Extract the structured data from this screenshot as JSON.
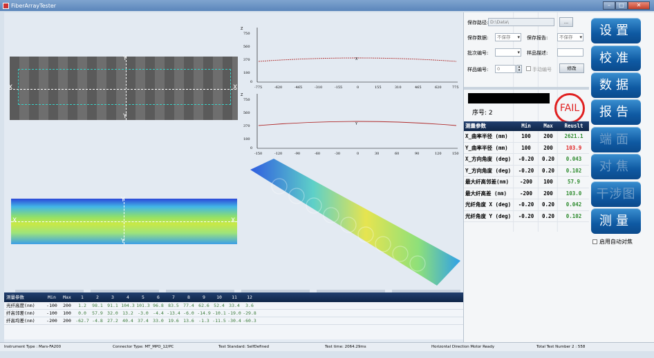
{
  "window": {
    "title": "FiberArrayTester",
    "min": "–",
    "max": "□",
    "close": "✕"
  },
  "images": {
    "img1_labels": {
      "left": "X",
      "right": "X",
      "top": "Y",
      "bottom": "Y"
    },
    "heat_labels": {
      "left": "X",
      "right": "X",
      "top": "Y",
      "bottom": "Y"
    }
  },
  "plot1": {
    "y_ticks": [
      "750",
      "560",
      "370",
      "180",
      "0"
    ],
    "x_ticks": [
      "-775",
      "-620",
      "-465",
      "-310",
      "-155",
      "0",
      "155",
      "310",
      "465",
      "620",
      "775"
    ],
    "y_letter": "Z",
    "marker": "X"
  },
  "plot2": {
    "y_ticks": [
      "750",
      "560",
      "370",
      "180",
      "0"
    ],
    "x_ticks": [
      "-150",
      "-120",
      "-90",
      "-60",
      "-30",
      "0",
      "30",
      "60",
      "90",
      "120",
      "150"
    ],
    "y_letter": "Z",
    "marker": "Y"
  },
  "nav": [
    "< < <",
    "< <",
    "<",
    ">",
    "> >",
    "> > >"
  ],
  "bottom_table": {
    "headers": [
      "测量参数",
      "Min",
      "Max",
      "1",
      "2",
      "3",
      "4",
      "5",
      "6",
      "7",
      "8",
      "9",
      "10",
      "11",
      "12"
    ],
    "rows": [
      [
        "光纤高度(nm)",
        "-100",
        "200",
        "1.2",
        "98.1",
        "91.1",
        "104.3",
        "101.3",
        "96.8",
        "83.5",
        "77.4",
        "62.6",
        "52.4",
        "33.4",
        "3.6"
      ],
      [
        "纤高邻差(nm)",
        "-100",
        "100",
        "0.0",
        "57.9",
        "32.0",
        "13.2",
        "-3.0",
        "-4.4",
        "-13.4",
        "-6.0",
        "-14.9",
        "-10.1",
        "-19.0",
        "-29.8"
      ],
      [
        "纤高均差(nm)",
        "-200",
        "200",
        "-62.7",
        "-4.8",
        "27.2",
        "40.4",
        "37.4",
        "33.0",
        "19.6",
        "13.6",
        "-1.3",
        "-11.5",
        "-30.4",
        "-60.3"
      ]
    ]
  },
  "status": {
    "instrument": "Instrument Type : Mars-FA200",
    "connector": "Connector Type:  MT_MPO_12/PC",
    "standard": "Test Standard:  SelfDefined",
    "time": "Test time: 2064.29ms",
    "motor": "Horizontal Direction Motor Ready",
    "total": "Total Test Number 2 :  558"
  },
  "form": {
    "save_path_label": "保存路径:",
    "save_path_value": "D:\\Data\\",
    "browse": "...",
    "save_data_label": "保存数据:",
    "save_data_value": "不保存",
    "save_report_label": "保存报告:",
    "save_report_value": "不保存",
    "batch_label": "批次编号:",
    "sample_desc_label": "样品描述:",
    "sample_no_label": "样品编号:",
    "sample_no_value": "0",
    "manual_no_label": "手动编号",
    "modify": "修改"
  },
  "result": {
    "seq_label": "序号:",
    "seq_value": "2",
    "verdict": "FAIL",
    "headers": [
      "测量参数",
      "Min",
      "Max",
      "Reuslt"
    ],
    "rows": [
      {
        "name": "X_曲率半径  (mm)",
        "min": "100",
        "max": "200",
        "result": "2621.1",
        "pass": true
      },
      {
        "name": "Y_曲率半径  (mm)",
        "min": "100",
        "max": "200",
        "result": "103.9",
        "pass": false
      },
      {
        "name": "X_方向角度 (deg)",
        "min": "-0.20",
        "max": "0.20",
        "result": "0.043",
        "pass": true
      },
      {
        "name": "Y_方向角度 (deg)",
        "min": "-0.20",
        "max": "0.20",
        "result": "0.102",
        "pass": true
      },
      {
        "name": "最大纤高邻差(nm)",
        "min": "-200",
        "max": "100",
        "result": "57.9",
        "pass": true
      },
      {
        "name": "最大纤高差   (nm)",
        "min": "-200",
        "max": "200",
        "result": "103.0",
        "pass": true
      },
      {
        "name": "光纤角度 X (deg)",
        "min": "-0.20",
        "max": "0.20",
        "result": "0.042",
        "pass": true
      },
      {
        "name": "光纤角度 Y (deg)",
        "min": "-0.20",
        "max": "0.20",
        "result": "0.102",
        "pass": true
      }
    ]
  },
  "sidebar": {
    "buttons": [
      "设置",
      "校准",
      "数据",
      "报告",
      "端面",
      "对焦",
      "干涉图",
      "测量"
    ],
    "autofocus": "启用自动对焦"
  },
  "colors": {
    "pass": "#2e8b2e",
    "fail": "#e02020",
    "accent": "#0f5aa3"
  }
}
